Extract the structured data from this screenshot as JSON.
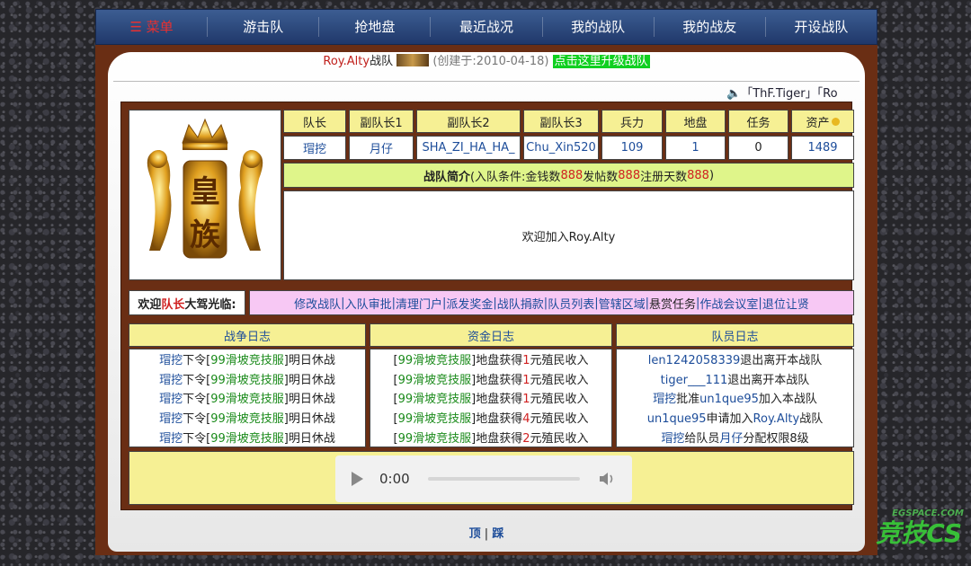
{
  "nav": {
    "items": [
      "☰ 菜单",
      "游击队",
      "抢地盘",
      "最近战况",
      "我的战队",
      "我的战友",
      "开设战队"
    ]
  },
  "header": {
    "team_name": "Roy.Alty",
    "team_suffix": "战队",
    "created": "(创建于:2010-04-18)",
    "upgrade_link": "点击这里升级战队",
    "ticker": "「ThF.Tiger」「Ro"
  },
  "logo": {
    "text_top": "皇",
    "text_bottom": "族"
  },
  "stats": {
    "headers": [
      "队长",
      "副队长1",
      "副队长2",
      "副队长3",
      "兵力",
      "地盘",
      "任务",
      "资产"
    ],
    "values": [
      "瑁挖",
      "月仔",
      "SHA_ZI_HA_HA_",
      "Chu_Xin520",
      "109",
      "1",
      "0",
      "1489"
    ]
  },
  "intro": {
    "title": "战队简介",
    "cond_prefix": "(入队条件:金钱数",
    "money": "888",
    "posts_label": " 发帖数",
    "posts": "888",
    "days_label": " 注册天数",
    "days": "888",
    "cond_suffix": ")",
    "message": "欢迎加入Roy.Alty"
  },
  "welcome": {
    "prefix": "欢迎",
    "role": "队长",
    "suffix": "大驾光临:"
  },
  "admin_links": [
    "修改战队",
    "入队审批",
    "清理门户",
    "派发奖金",
    "战队捐款",
    "队员列表",
    "管辖区域",
    "悬赏任务",
    "作战会议室",
    "退位让贤"
  ],
  "logs": {
    "war_title": "战争日志",
    "fund_title": "资金日志",
    "member_title": "队员日志",
    "war": [
      [
        "瑁挖",
        "下令[",
        "99滑坡竞技服",
        "]明日休战"
      ],
      [
        "瑁挖",
        "下令[",
        "99滑坡竞技服",
        "]明日休战"
      ],
      [
        "瑁挖",
        "下令[",
        "99滑坡竞技服",
        "]明日休战"
      ],
      [
        "瑁挖",
        "下令[",
        "99滑坡竞技服",
        "]明日休战"
      ],
      [
        "瑁挖",
        "下令[",
        "99滑坡竞技服",
        "]明日休战"
      ]
    ],
    "fund": [
      [
        "[",
        "99滑坡竞技服",
        "]地盘获得",
        "1",
        "元殖民收入"
      ],
      [
        "[",
        "99滑坡竞技服",
        "]地盘获得",
        "1",
        "元殖民收入"
      ],
      [
        "[",
        "99滑坡竞技服",
        "]地盘获得",
        "1",
        "元殖民收入"
      ],
      [
        "[",
        "99滑坡竞技服",
        "]地盘获得",
        "4",
        "元殖民收入"
      ],
      [
        "[",
        "99滑坡竞技服",
        "]地盘获得",
        "2",
        "元殖民收入"
      ]
    ],
    "member": [
      [
        "len1242058339",
        "退出离开本战队",
        "",
        ""
      ],
      [
        "tiger___111",
        "退出离开本战队",
        "",
        ""
      ],
      [
        "瑁挖",
        "批准",
        "un1que95",
        "加入本战队"
      ],
      [
        "un1que95",
        "申请加入",
        "Roy.Alty",
        "战队"
      ],
      [
        "瑁挖",
        "给队员",
        "月仔",
        "分配权限8级"
      ]
    ]
  },
  "audio": {
    "time": "0:00"
  },
  "footer": {
    "top": "顶",
    "sep": " | ",
    "step": "踩"
  },
  "watermark": {
    "text": "EGSPACE.COM",
    "brand": "竞技CS"
  },
  "colors": {
    "nav": "#2b4a80",
    "frame": "#6a2e14",
    "head": "#f6f094",
    "admin": "#f7c8f4",
    "intro_bar": "#dff58a"
  }
}
